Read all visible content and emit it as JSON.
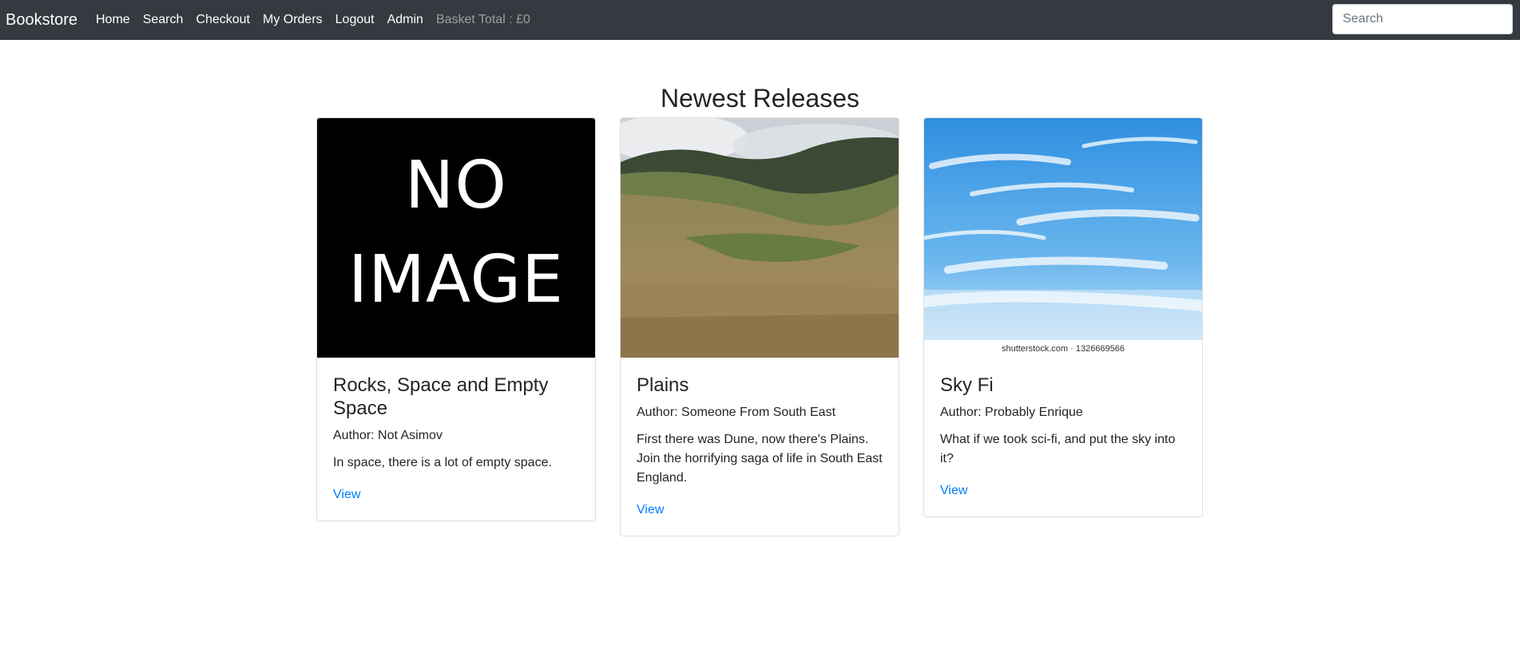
{
  "nav": {
    "brand": "Bookstore",
    "links": [
      "Home",
      "Search",
      "Checkout",
      "My Orders",
      "Logout",
      "Admin"
    ],
    "basket_total": "Basket Total : £0",
    "search_placeholder": "Search"
  },
  "main": {
    "heading": "Newest Releases",
    "books": [
      {
        "title": "Rocks, Space and Empty Space",
        "author": "Author: Not Asimov",
        "description": "In space, there is a lot of empty space.",
        "link": "View",
        "image": {
          "type": "no-image-placeholder",
          "line1": "NO",
          "line2": "IMAGE"
        }
      },
      {
        "title": "Plains",
        "author": "Author: Someone From South East",
        "description": "First there was Dune, now there's Plains. Join the horrifying saga of life in South East England.",
        "link": "View",
        "image": {
          "type": "grassland-photo"
        }
      },
      {
        "title": "Sky Fi",
        "author": "Author: Probably Enrique",
        "description": "What if we took sci-fi, and put the sky into it?",
        "link": "View",
        "image": {
          "type": "sky-photo",
          "watermark": "shutterstock.com · 1326669566"
        }
      }
    ]
  },
  "colors": {
    "navbar_bg": "#343a40",
    "link": "#007bff",
    "text": "#212529"
  }
}
